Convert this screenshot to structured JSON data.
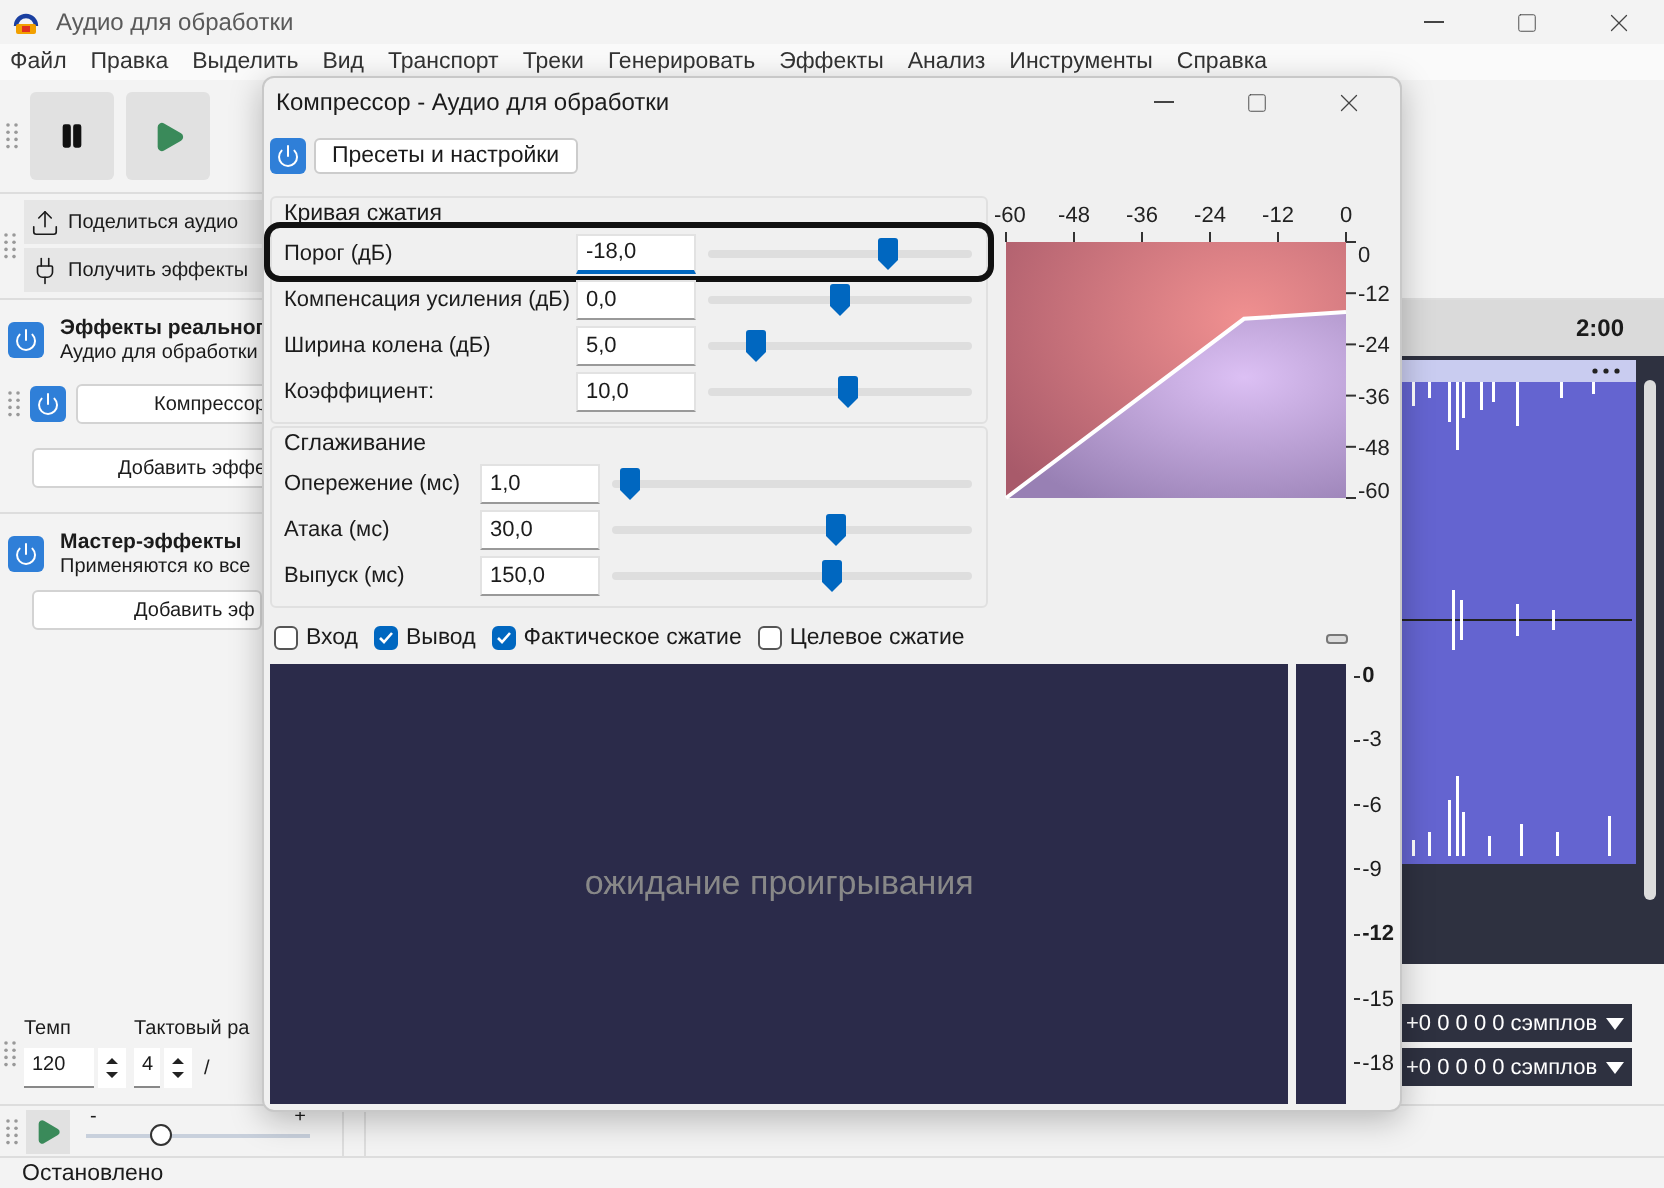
{
  "window": {
    "title": "Аудио для обработки"
  },
  "menu": [
    "Файл",
    "Правка",
    "Выделить",
    "Вид",
    "Транспорт",
    "Треки",
    "Генерировать",
    "Эффекты",
    "Анализ",
    "Инструменты",
    "Справка"
  ],
  "share_toolbar": [
    "Поделиться аудио",
    "Получить эффекты"
  ],
  "realtime_effects": {
    "title": "Эффекты реальног",
    "subtitle": "Аудио для обработки",
    "effect": "Компрессор",
    "add_button": "Добавить эффе"
  },
  "master_effects": {
    "title": "Мастер-эффекты",
    "subtitle": "Применяются ко все",
    "add_button": "Добавить эф"
  },
  "tempo": {
    "label": "Темп",
    "value": "120"
  },
  "time_signature": {
    "label": "Тактовый ра",
    "upper": "4",
    "separator": "/"
  },
  "play_at_speed": {
    "minus": "-",
    "plus": "+",
    "level": 0.33
  },
  "timeline": {
    "label": "2:00"
  },
  "selection": [
    "+0 0 0 0 0 сэмплов",
    "+0 0 0 0 0 сэмплов"
  ],
  "status_bar": "Остановлено",
  "dialog": {
    "title": "Компрессор - Аудио для обработки",
    "presets_button": "Пресеты и настройки",
    "groups": [
      {
        "title": "Кривая сжатия",
        "params": [
          {
            "label": "Порог (дБ)",
            "value": "-18,0",
            "level": 0.68,
            "focused": true,
            "highlighted": true
          },
          {
            "label": "Компенсация усиления (дБ)",
            "value": "0,0",
            "level": 0.5,
            "focused": false,
            "highlighted": false
          },
          {
            "label": "Ширина колена (дБ)",
            "value": "5,0",
            "level": 0.18,
            "focused": false,
            "highlighted": false
          },
          {
            "label": "Коэффициент:",
            "value": "10,0",
            "level": 0.53,
            "focused": false,
            "highlighted": false
          }
        ]
      },
      {
        "title": "Сглаживание",
        "params": [
          {
            "label": "Опережение (мс)",
            "value": "1,0",
            "level": 0.05,
            "focused": false,
            "highlighted": false
          },
          {
            "label": "Атака (мс)",
            "value": "30,0",
            "level": 0.62,
            "focused": false,
            "highlighted": false
          },
          {
            "label": "Выпуск (мс)",
            "value": "150,0",
            "level": 0.61,
            "focused": false,
            "highlighted": false
          }
        ]
      }
    ],
    "chart_data": {
      "type": "line",
      "x": [
        -60,
        -18,
        0
      ],
      "series": [
        {
          "color": "#ffffff",
          "values": [
            -60,
            -18,
            -16.4
          ]
        }
      ],
      "xlim": [
        -60,
        0
      ],
      "ylim": [
        -60,
        0
      ],
      "xticks": [
        -60,
        -48,
        -36,
        -24,
        -12,
        0
      ],
      "yticks": [
        0,
        -12,
        -24,
        -36,
        -48,
        -60
      ]
    },
    "checkboxes": [
      {
        "label": "Вход",
        "checked": false
      },
      {
        "label": "Вывод",
        "checked": true
      },
      {
        "label": "Фактическое сжатие",
        "checked": true
      },
      {
        "label": "Целевое сжатие",
        "checked": false
      }
    ],
    "monitor": {
      "message": "ожидание проигрывания",
      "meter_scale": [
        {
          "label": "0",
          "bold": true
        },
        {
          "label": "-3",
          "bold": false
        },
        {
          "label": "-6",
          "bold": false
        },
        {
          "label": "-9",
          "bold": false
        },
        {
          "label": "-12",
          "bold": true
        },
        {
          "label": "-15",
          "bold": false
        },
        {
          "label": "-18",
          "bold": false
        }
      ]
    }
  }
}
